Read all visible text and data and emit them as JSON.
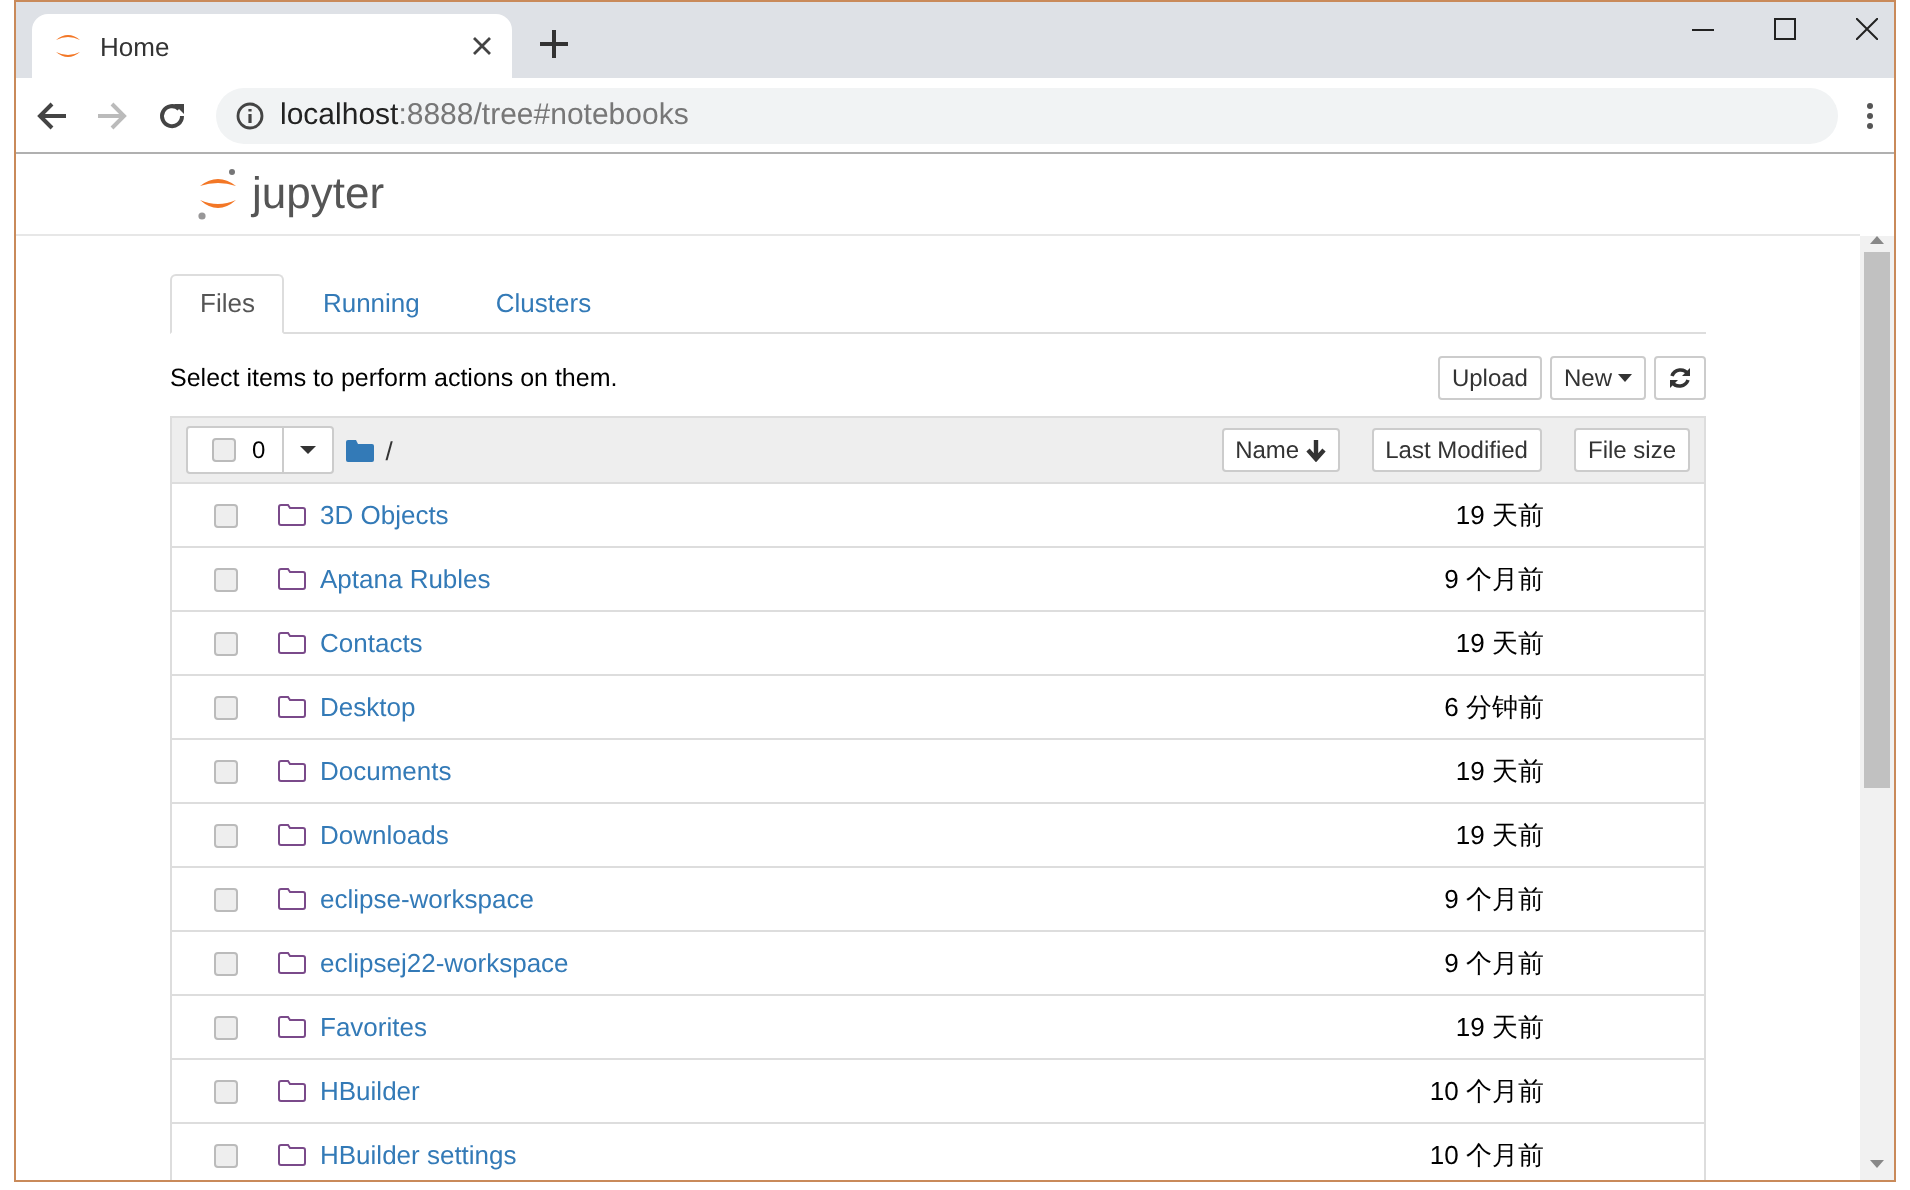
{
  "browser": {
    "tab_title": "Home",
    "url_host": "localhost",
    "url_path": ":8888/tree#notebooks"
  },
  "app": {
    "logo_text": "jupyter"
  },
  "tabs": [
    {
      "label": "Files",
      "selected": true
    },
    {
      "label": "Running",
      "selected": false
    },
    {
      "label": "Clusters",
      "selected": false
    }
  ],
  "toolbar": {
    "hint": "Select items to perform actions on them.",
    "buttons": [
      "Upload",
      "New"
    ]
  },
  "list_header": {
    "select_all_checked": false,
    "selected_count": "0",
    "path": "/",
    "sort_buttons": [
      "Name",
      "Last Modified",
      "File size"
    ]
  },
  "rows": [
    {
      "name": "3D Objects",
      "modified": "19 天前",
      "checked": false
    },
    {
      "name": "Aptana Rubles",
      "modified": "9 个月前",
      "checked": false
    },
    {
      "name": "Contacts",
      "modified": "19 天前",
      "checked": false
    },
    {
      "name": "Desktop",
      "modified": "6 分钟前",
      "checked": false
    },
    {
      "name": "Documents",
      "modified": "19 天前",
      "checked": false
    },
    {
      "name": "Downloads",
      "modified": "19 天前",
      "checked": false
    },
    {
      "name": "eclipse-workspace",
      "modified": "9 个月前",
      "checked": false
    },
    {
      "name": "eclipsej22-workspace",
      "modified": "9 个月前",
      "checked": false
    },
    {
      "name": "Favorites",
      "modified": "19 天前",
      "checked": false
    },
    {
      "name": "HBuilder",
      "modified": "10 个月前",
      "checked": false
    },
    {
      "name": "HBuilder settings",
      "modified": "10 个月前",
      "checked": false
    }
  ]
}
